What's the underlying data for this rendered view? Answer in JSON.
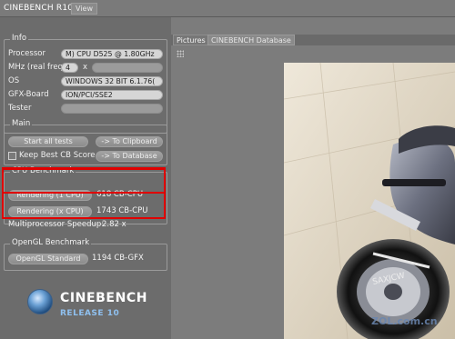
{
  "app": {
    "title": "CINEBENCH R10",
    "view_tab": "View"
  },
  "info": {
    "title": "Info",
    "rows": [
      {
        "label": "Processor",
        "value": "M) CPU D525 @ 1.80GHz"
      },
      {
        "label": "MHz (real freq.)",
        "value": "4",
        "multiplier": "x"
      },
      {
        "label": "OS",
        "value": "WINDOWS 32 BIT 6.1.76("
      },
      {
        "label": "GFX-Board",
        "value": "ION/PCI/SSE2"
      },
      {
        "label": "Tester",
        "value": ""
      }
    ]
  },
  "main": {
    "title": "Main",
    "start_all_tests": "Start all tests",
    "to_clipboard": "-> To Clipboard",
    "keep_best_label": "Keep Best CB Score",
    "to_database": "-> To Database"
  },
  "cpu_benchmark": {
    "title": "CPU Benchmark",
    "rendering_1cpu_label": "Rendering (1 CPU)",
    "rendering_1cpu_score": "618 CB-CPU",
    "rendering_xcpu_label": "Rendering (x CPU)",
    "rendering_xcpu_score": "1743 CB-CPU",
    "speedup_label": "Multiprocessor Speedup:",
    "speedup_value": "2.82 x"
  },
  "opengl_benchmark": {
    "title": "OpenGL Benchmark",
    "button_label": "OpenGL Standard",
    "score": "1194 CB-GFX"
  },
  "logo": {
    "name": "CINEBENCH",
    "release": "RELEASE 10"
  },
  "right": {
    "tabs": [
      "Pictures",
      "CINEBENCH Database"
    ]
  },
  "colors": {
    "highlight": "#e00000",
    "logo_accent": "#8fc0ef"
  }
}
